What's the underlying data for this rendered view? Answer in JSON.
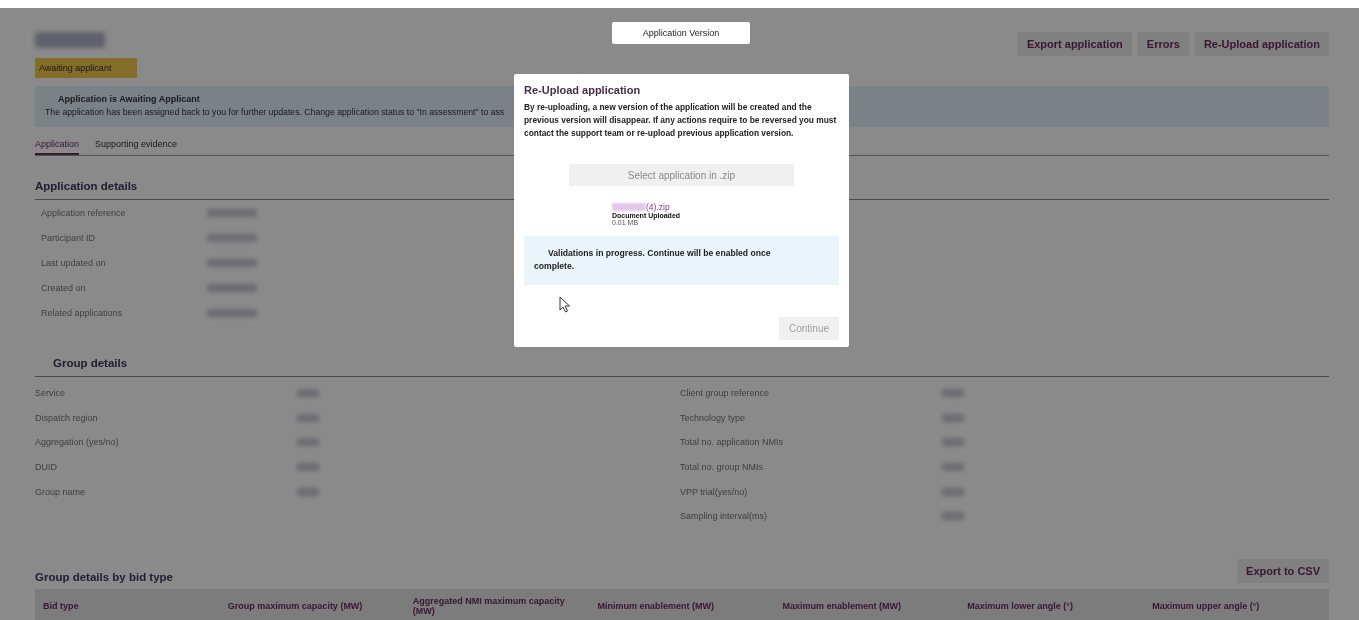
{
  "app_version_button": "Application Version",
  "header": {
    "status_badge": "Awaiting applicant",
    "actions": [
      "Export application",
      "Errors",
      "Re-Upload application"
    ]
  },
  "notice": {
    "title": "Application is Awaiting Applicant",
    "text": "The application has been assigned back to you for further updates. Change application status to \"In assessment\" to ass"
  },
  "tabs": [
    {
      "label": "Application",
      "selected": true
    },
    {
      "label": "Supporting evidence",
      "selected": false
    }
  ],
  "application_details": {
    "title": "Application details",
    "fields": [
      "Application reference",
      "Participant ID",
      "Last updated on",
      "Created on",
      "Related applications"
    ]
  },
  "group_details": {
    "title": "Group details",
    "left_fields": [
      "Service",
      "Dispatch region",
      "Aggregation (yes/no)",
      "DUID",
      "Group name"
    ],
    "right_fields": [
      "Client group reference",
      "Technology type",
      "Total no. application NMIs",
      "Total no. group NMIs",
      "VPP trial(yes/no)",
      "Sampling interval(ms)"
    ]
  },
  "bid_table": {
    "title": "Group details by bid type",
    "export_button": "Export to CSV",
    "columns": [
      "Bid type",
      "Group maximum capacity (MW)",
      "Aggregated NMI maximum capacity (MW)",
      "Minimum enablement (MW)",
      "Maximum enablement (MW)",
      "Maximum lower angle (°)",
      "Maximum upper angle (°)"
    ]
  },
  "dialog": {
    "title": "Re-Upload application",
    "message": "By re-uploading, a new version of the application will be created and the previous version will disappear. If any actions require to be reversed you must contact the support team or re-upload previous application version.",
    "select_button": "Select application in .zip",
    "file": {
      "name": "(4).zip",
      "status": "Document Uploaded",
      "size": "0.01 MB"
    },
    "notice": "Validations in progress. Continue will be enabled once complete.",
    "continue_button": {
      "label": "Continue",
      "disabled": true
    }
  }
}
